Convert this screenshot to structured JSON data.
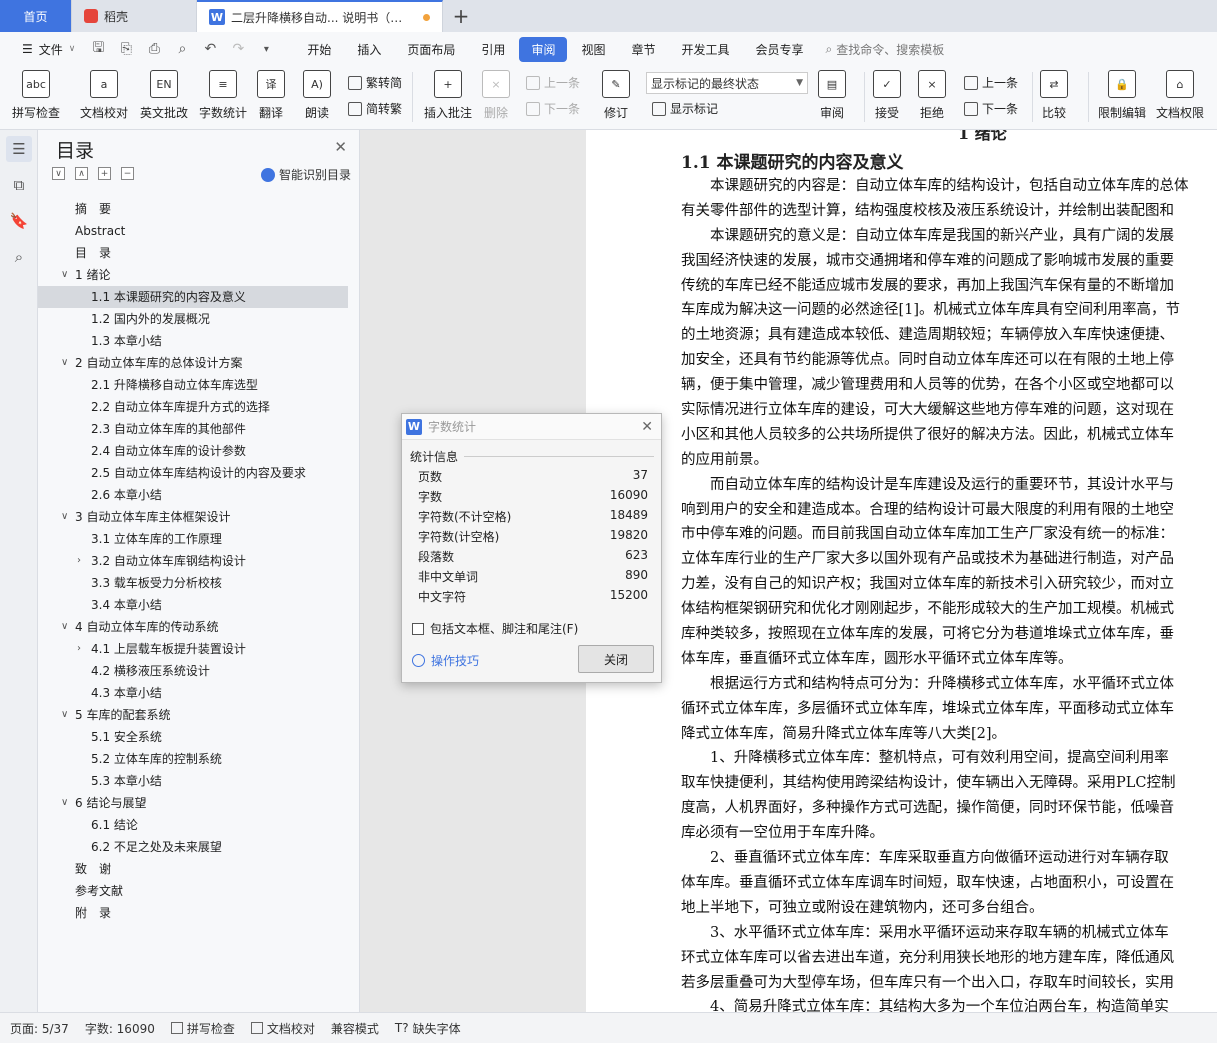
{
  "tabs": {
    "home": "首页",
    "daoke": "稻壳",
    "document": "二层升降横移自动... 说明书（论文）",
    "add": "+"
  },
  "menu": {
    "file": "文件",
    "items": [
      "开始",
      "插入",
      "页面布局",
      "引用",
      "审阅",
      "视图",
      "章节",
      "开发工具",
      "会员专享"
    ],
    "active": "审阅",
    "search": "查找命令、搜索模板"
  },
  "ribbon": {
    "spell_check": "拼写检查",
    "doc_proof": "文档校对",
    "english_review": "英文批改",
    "word_count": "字数统计",
    "translate": "翻译",
    "read_aloud": "朗读",
    "trad_to_simp": "繁转简",
    "simp_to_trad": "简转繁",
    "insert_comment": "插入批注",
    "delete": "删除",
    "prev_comment": "上一条",
    "next_comment": "下一条",
    "track_changes": "修订",
    "markup_state": "显示标记的最终状态",
    "show_markup": "显示标记",
    "review": "审阅",
    "accept": "接受",
    "reject": "拒绝",
    "prev_change": "上一条",
    "next_change": "下一条",
    "compare": "比较",
    "restrict_edit": "限制编辑",
    "doc_permission": "文档权限"
  },
  "toc": {
    "title": "目录",
    "smart": "智能识别目录",
    "items": [
      {
        "text": "摘　要",
        "level": 0,
        "caret": ""
      },
      {
        "text": "Abstract",
        "level": 0,
        "caret": ""
      },
      {
        "text": "目　录",
        "level": 0,
        "caret": ""
      },
      {
        "text": "1  绪论",
        "level": 0,
        "caret": "v"
      },
      {
        "text": "1.1  本课题研究的内容及意义",
        "level": 1,
        "caret": "",
        "selected": true
      },
      {
        "text": "1.2 国内外的发展概况",
        "level": 1,
        "caret": ""
      },
      {
        "text": "1.3 本章小结",
        "level": 1,
        "caret": ""
      },
      {
        "text": "2  自动立体车库的总体设计方案",
        "level": 0,
        "caret": "v"
      },
      {
        "text": "2.1  升降横移自动立体车库选型",
        "level": 1,
        "caret": ""
      },
      {
        "text": "2.2  自动立体车库提升方式的选择",
        "level": 1,
        "caret": ""
      },
      {
        "text": "2.3  自动立体车库的其他部件",
        "level": 1,
        "caret": ""
      },
      {
        "text": "2.4  自动立体车库的设计参数",
        "level": 1,
        "caret": ""
      },
      {
        "text": "2.5  自动立体车库结构设计的内容及要求",
        "level": 1,
        "caret": ""
      },
      {
        "text": "2.6  本章小结",
        "level": 1,
        "caret": ""
      },
      {
        "text": "3  自动立体车库主体框架设计",
        "level": 0,
        "caret": "v"
      },
      {
        "text": "3.1 立体车库的工作原理",
        "level": 1,
        "caret": ""
      },
      {
        "text": "3.2 自动立体车库钢结构设计",
        "level": 1,
        "caret": ">"
      },
      {
        "text": "3.3  载车板受力分析校核",
        "level": 1,
        "caret": ""
      },
      {
        "text": "3.4 本章小结",
        "level": 1,
        "caret": ""
      },
      {
        "text": "4  自动立体车库的传动系统",
        "level": 0,
        "caret": "v"
      },
      {
        "text": "4.1  上层载车板提升装置设计",
        "level": 1,
        "caret": ">"
      },
      {
        "text": "4.2  横移液压系统设计",
        "level": 1,
        "caret": ""
      },
      {
        "text": "4.3 本章小结",
        "level": 1,
        "caret": ""
      },
      {
        "text": "5  车库的配套系统",
        "level": 0,
        "caret": "v"
      },
      {
        "text": "5.1  安全系统",
        "level": 1,
        "caret": ""
      },
      {
        "text": "5.2  立体车库的控制系统",
        "level": 1,
        "caret": ""
      },
      {
        "text": "5.3  本章小结",
        "level": 1,
        "caret": ""
      },
      {
        "text": "6  结论与展望",
        "level": 0,
        "caret": "v"
      },
      {
        "text": "6.1 结论",
        "level": 1,
        "caret": ""
      },
      {
        "text": "6.2 不足之处及未来展望",
        "level": 1,
        "caret": ""
      },
      {
        "text": "致　谢",
        "level": 0,
        "caret": ""
      },
      {
        "text": "参考文献",
        "level": 0,
        "caret": ""
      },
      {
        "text": "附　录",
        "level": 0,
        "caret": ""
      }
    ]
  },
  "document": {
    "top_heading": "1  绪论",
    "section_heading": "1.1  本课题研究的内容及意义",
    "lines": [
      "　　本课题研究的内容是：自动立体车库的结构设计，包括自动立体车库的总体",
      "有关零件部件的选型计算，结构强度校核及液压系统设计，并绘制出装配图和",
      "　　本课题研究的意义是：自动立体车库是我国的新兴产业，具有广阔的发展",
      "我国经济快速的发展，城市交通拥堵和停车难的问题成了影响城市发展的重要",
      "传统的车库已经不能适应城市发展的要求，再加上我国汽车保有量的不断增加",
      "车库成为解决这一问题的必然途径[1]。机械式立体车库具有空间利用率高，节",
      "的土地资源；具有建造成本较低、建造周期较短；车辆停放入车库快速便捷、",
      "加安全，还具有节约能源等优点。同时自动立体车库还可以在有限的土地上停",
      "辆，便于集中管理，减少管理费用和人员等的优势，在各个小区或空地都可以",
      "实际情况进行立体车库的建设，可大大缓解这些地方停车难的问题，这对现在",
      "小区和其他人员较多的公共场所提供了很好的解决方法。因此，机械式立体车",
      "的应用前景。",
      "　　而自动立体车库的结构设计是车库建设及运行的重要环节，其设计水平与",
      "响到用户的安全和建造成本。合理的结构设计可最大限度的利用有限的土地空",
      "市中停车难的问题。而目前我国自动立体车库加工生产厂家没有统一的标准：",
      "立体车库行业的生产厂家大多以国外现有产品或技术为基础进行制造，对产品",
      "力差，没有自己的知识产权；我国对立体车库的新技术引入研究较少，而对立",
      "体结构框架钢研究和优化才刚刚起步，不能形成较大的生产加工规模。机械式",
      "库种类较多，按照现在立体车库的发展，可将它分为巷道堆垛式立体车库，垂",
      "体车库，垂直循环式立体车库，圆形水平循环式立体车库等。",
      "　　根据运行方式和结构特点可分为：升降横移式立体车库，水平循环式立体",
      "循环式立体车库，多层循环式立体车库，堆垛式立体车库，平面移动式立体车",
      "降式立体车库，简易升降式立体车库等八大类[2]。",
      "　　1、升降横移式立体车库：整机特点，可有效利用空间，提高空间利用率",
      "取车快捷便利，其结构使用跨梁结构设计，使车辆出入无障碍。采用PLC控制",
      "度高，人机界面好，多种操作方式可选配，操作简便，同时环保节能，低噪音",
      "库必须有一空位用于车库升降。",
      "　　2、垂直循环式立体车库：车库采取垂直方向做循环运动进行对车辆存取",
      "体车库。垂直循环式立体车库调车时间短，取车快速，占地面积小，可设置在",
      "地上半地下，可独立或附设在建筑物内，还可多台组合。",
      "　　3、水平循环式立体车库：采用水平循环运动来存取车辆的机械式立体车",
      "环式立体车库可以省去进出车道，充分利用狭长地形的地方建车库，降低通风",
      "若多层重叠可为大型停车场，但车库只有一个出入口，存取车时间较长，实用",
      "　　4、简易升降式立体车库：其结构大多为一个车位泊两台车，构造简单实"
    ]
  },
  "dialog": {
    "title": "字数统计",
    "section": "统计信息",
    "rows": [
      {
        "label": "页数",
        "value": "37"
      },
      {
        "label": "字数",
        "value": "16090"
      },
      {
        "label": "字符数(不计空格)",
        "value": "18489"
      },
      {
        "label": "字符数(计空格)",
        "value": "19820"
      },
      {
        "label": "段落数",
        "value": "623"
      },
      {
        "label": "非中文单词",
        "value": "890"
      },
      {
        "label": "中文字符",
        "value": "15200"
      }
    ],
    "checkbox": "包括文本框、脚注和尾注(F)",
    "tips": "操作技巧",
    "close": "关闭"
  },
  "status": {
    "page": "页面: 5/37",
    "words": "字数: 16090",
    "spell": "拼写检查",
    "proof": "文档校对",
    "compat": "兼容模式",
    "missing_font": "缺失字体"
  },
  "colors": {
    "accent": "#3f74e0",
    "link": "#3f74e0"
  }
}
